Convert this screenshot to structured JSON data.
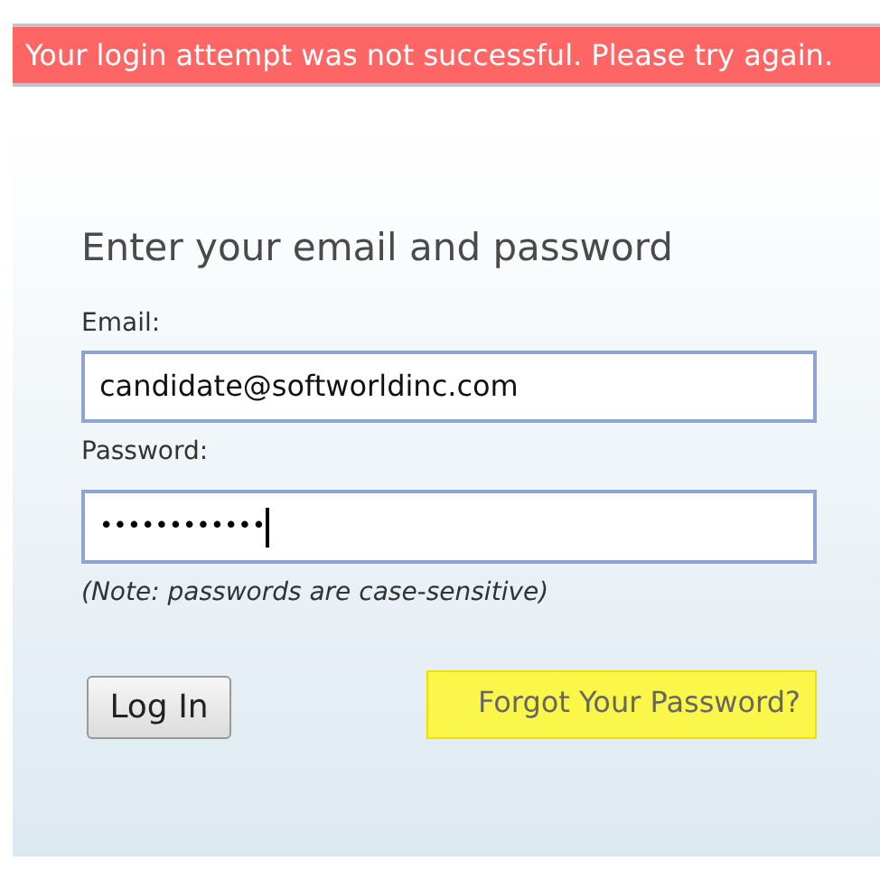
{
  "error_banner": "Your login attempt was not successful. Please try again.",
  "heading": "Enter your email and password",
  "email": {
    "label": "Email:",
    "value": "candidate@softworldinc.com"
  },
  "password": {
    "label": "Password:",
    "value": "••••••••••••"
  },
  "note": "(Note: passwords are case-sensitive)",
  "login_button": "Log In",
  "forgot_link": "Forgot Your Password?"
}
